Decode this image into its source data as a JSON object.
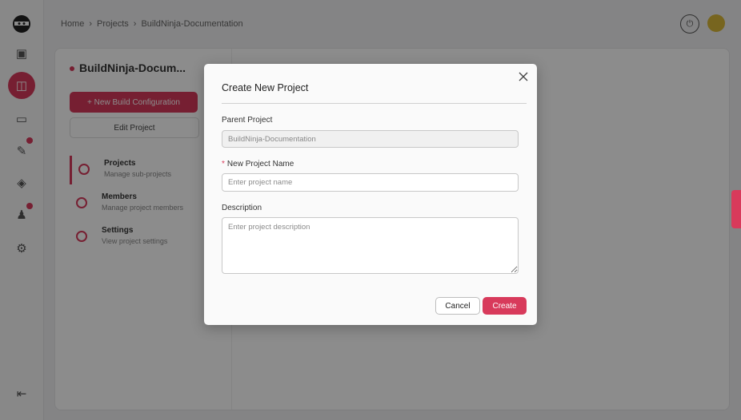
{
  "breadcrumbs": [
    "Home",
    "Projects",
    "BuildNinja-Documentation"
  ],
  "background": {
    "project_title": "BuildNinja-Docum...",
    "new_build_config_label": "+ New Build Configuration",
    "edit_project_label": "Edit Project",
    "nav": [
      {
        "title": "Projects",
        "subtitle": "Manage sub-projects"
      },
      {
        "title": "Members",
        "subtitle": "Manage project members"
      },
      {
        "title": "Settings",
        "subtitle": "View project settings"
      }
    ]
  },
  "modal": {
    "title": "Create New Project",
    "close_icon": "close-icon",
    "parent_project": {
      "label": "Parent Project",
      "value": "BuildNinja-Documentation"
    },
    "project_name": {
      "required_mark": "*",
      "label": "New Project Name",
      "value": "",
      "placeholder": "Enter project name"
    },
    "description": {
      "label": "Description",
      "value": "",
      "placeholder": "Enter project description"
    },
    "cancel_label": "Cancel",
    "create_label": "Create"
  },
  "colors": {
    "accent": "#d83a5b"
  }
}
